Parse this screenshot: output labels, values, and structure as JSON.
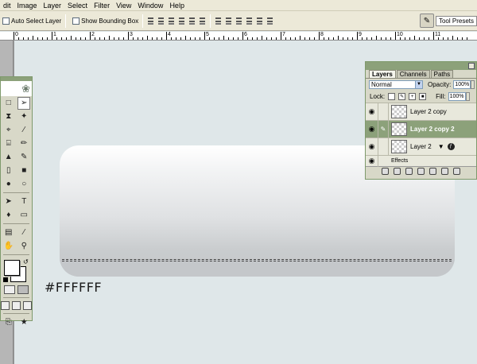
{
  "menu": [
    "dit",
    "Image",
    "Layer",
    "Select",
    "Filter",
    "View",
    "Window",
    "Help"
  ],
  "options": {
    "auto_select_layer": "Auto Select Layer",
    "show_bounding_box": "Show Bounding Box",
    "tool_presets": "Tool Presets"
  },
  "ruler": {
    "labels": [
      "0",
      "1",
      "2",
      "3",
      "4",
      "5",
      "6",
      "7",
      "8",
      "9",
      "10",
      "11"
    ]
  },
  "canvas": {
    "color_label": "#FFFFFF"
  },
  "layers_panel": {
    "tabs": [
      "Layers",
      "Channels",
      "Paths"
    ],
    "blend_mode": "Normal",
    "opacity_label": "Opacity:",
    "opacity_value": "100%",
    "lock_label": "Lock:",
    "fill_label": "Fill:",
    "fill_value": "100%",
    "layers": [
      {
        "name": "Layer 2 copy",
        "active": false,
        "has_effects": false
      },
      {
        "name": "Layer 2 copy 2",
        "active": true,
        "has_effects": false
      },
      {
        "name": "Layer 2",
        "active": false,
        "has_effects": true
      }
    ],
    "effects_label": "Effects"
  }
}
